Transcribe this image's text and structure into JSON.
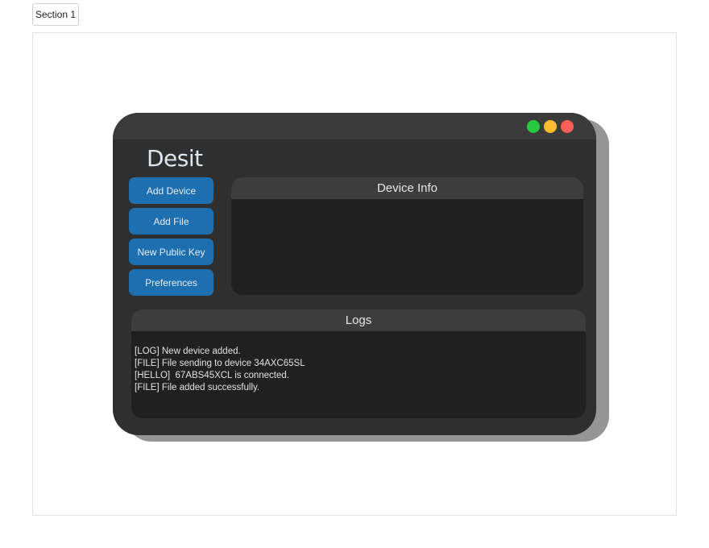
{
  "section_tab": "Section 1",
  "app": {
    "title": "Desit"
  },
  "sidebar": {
    "buttons": [
      {
        "label": "Add Device"
      },
      {
        "label": "Add File"
      },
      {
        "label": "New Public Key"
      },
      {
        "label": "Preferences"
      }
    ]
  },
  "device_info": {
    "header": "Device Info"
  },
  "logs": {
    "header": "Logs",
    "lines": [
      "[LOG] New device added.",
      "[FILE] File sending to device 34AXC65SL",
      "[HELLO]  67ABS45XCL is connected.",
      "[FILE] File added successfully."
    ]
  },
  "colors": {
    "window_bg": "#2f2f2f",
    "titlebar_bg": "#3b3b3b",
    "button_bg": "#1d6fb0",
    "panel_bg": "#202020",
    "traffic_green": "#28c840",
    "traffic_yellow": "#fdbc2e",
    "traffic_red": "#fe5f57"
  }
}
